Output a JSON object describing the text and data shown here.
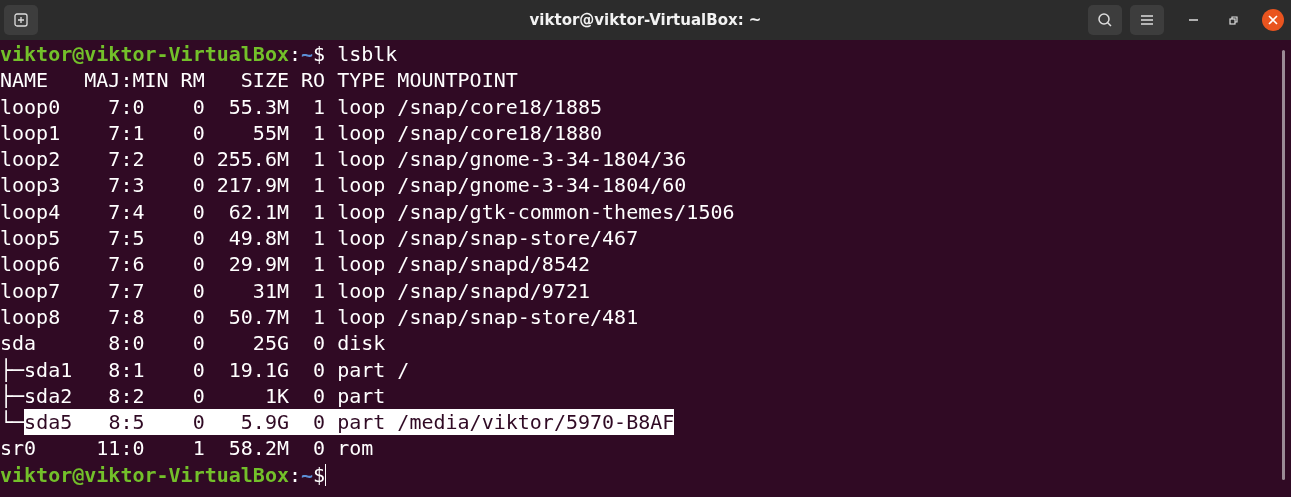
{
  "window": {
    "title": "viktor@viktor-VirtualBox: ~"
  },
  "lines": [
    {
      "kind": "prompt",
      "user_host": "viktor@viktor-VirtualBox",
      "separator": ":",
      "path": "~",
      "symbol": "$",
      "command": " lsblk",
      "cursor": false
    },
    {
      "kind": "output",
      "text": "NAME   MAJ:MIN RM   SIZE RO TYPE MOUNTPOINT",
      "selected": false
    },
    {
      "kind": "output",
      "text": "loop0    7:0    0  55.3M  1 loop /snap/core18/1885",
      "selected": false
    },
    {
      "kind": "output",
      "text": "loop1    7:1    0    55M  1 loop /snap/core18/1880",
      "selected": false
    },
    {
      "kind": "output",
      "text": "loop2    7:2    0 255.6M  1 loop /snap/gnome-3-34-1804/36",
      "selected": false
    },
    {
      "kind": "output",
      "text": "loop3    7:3    0 217.9M  1 loop /snap/gnome-3-34-1804/60",
      "selected": false
    },
    {
      "kind": "output",
      "text": "loop4    7:4    0  62.1M  1 loop /snap/gtk-common-themes/1506",
      "selected": false
    },
    {
      "kind": "output",
      "text": "loop5    7:5    0  49.8M  1 loop /snap/snap-store/467",
      "selected": false
    },
    {
      "kind": "output",
      "text": "loop6    7:6    0  29.9M  1 loop /snap/snapd/8542",
      "selected": false
    },
    {
      "kind": "output",
      "text": "loop7    7:7    0    31M  1 loop /snap/snapd/9721",
      "selected": false
    },
    {
      "kind": "output",
      "text": "loop8    7:8    0  50.7M  1 loop /snap/snap-store/481",
      "selected": false
    },
    {
      "kind": "output",
      "text": "sda      8:0    0    25G  0 disk",
      "selected": false
    },
    {
      "kind": "output",
      "text": "├─sda1   8:1    0  19.1G  0 part /",
      "selected": false
    },
    {
      "kind": "output",
      "text": "├─sda2   8:2    0     1K  0 part",
      "selected": false
    },
    {
      "kind": "output",
      "tree": "└─",
      "text": "sda5   8:5    0   5.9G  0 part /media/viktor/5970-B8AF",
      "selected": true
    },
    {
      "kind": "output",
      "text": "sr0     11:0    1  58.2M  0 rom",
      "selected": false
    },
    {
      "kind": "prompt",
      "user_host": "viktor@viktor-VirtualBox",
      "separator": ":",
      "path": "~",
      "symbol": "$",
      "cursor": true
    }
  ]
}
